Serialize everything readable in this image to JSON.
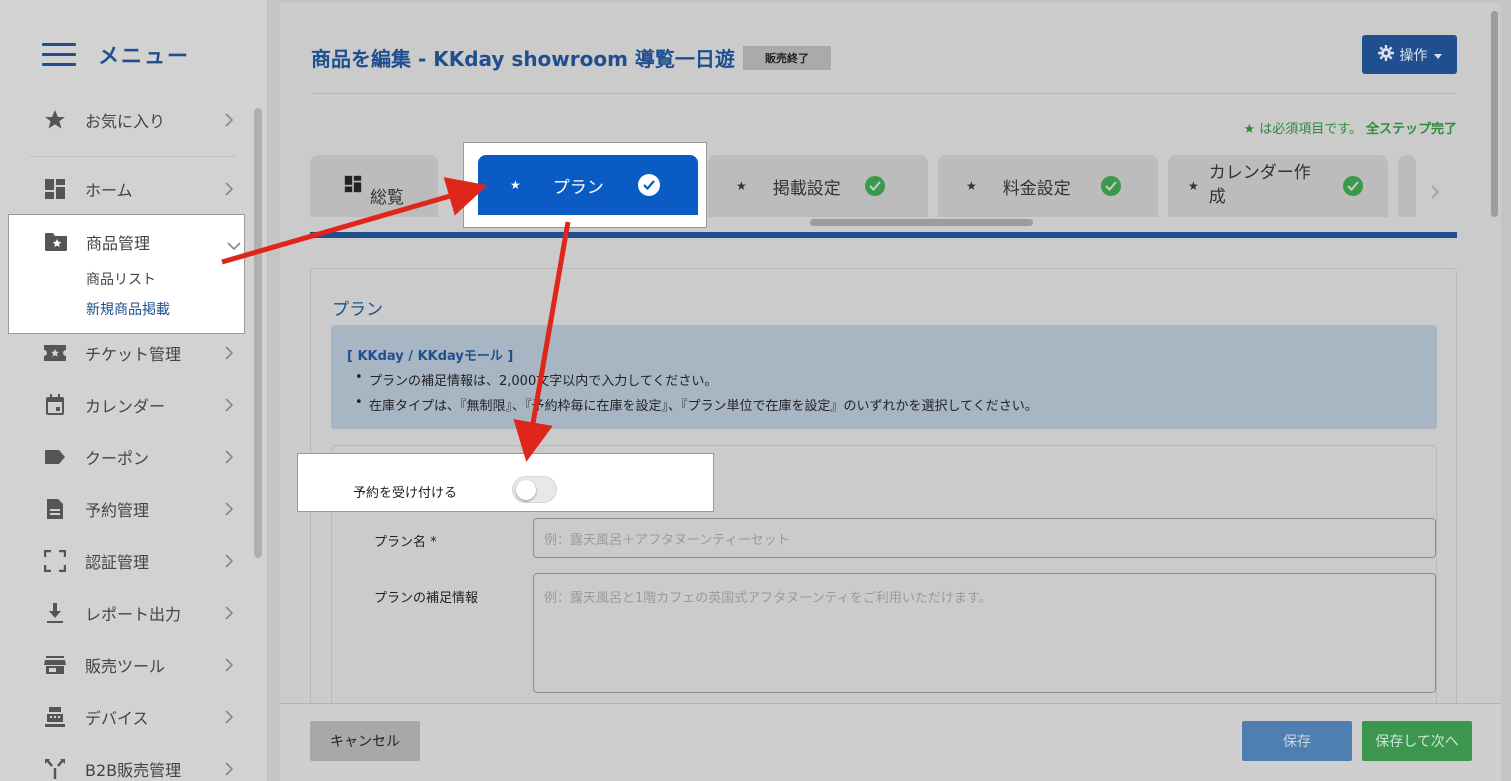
{
  "sidebar": {
    "menu_title": "メニュー",
    "items": [
      {
        "label": "お気に入り",
        "icon": "star-icon"
      },
      {
        "label": "ホーム",
        "icon": "dashboard-icon"
      },
      {
        "label": "商品管理",
        "icon": "folder-star-icon"
      },
      {
        "label": "チケット管理",
        "icon": "ticket-icon"
      },
      {
        "label": "カレンダー",
        "icon": "calendar-icon"
      },
      {
        "label": "クーポン",
        "icon": "tag-icon"
      },
      {
        "label": "予約管理",
        "icon": "document-icon"
      },
      {
        "label": "認証管理",
        "icon": "scan-icon"
      },
      {
        "label": "レポート出力",
        "icon": "download-icon"
      },
      {
        "label": "販売ツール",
        "icon": "store-icon"
      },
      {
        "label": "デバイス",
        "icon": "pos-icon"
      },
      {
        "label": "B2B販売管理",
        "icon": "split-icon"
      }
    ],
    "sub_items": [
      "商品リスト",
      "新規商品掲載"
    ]
  },
  "header": {
    "title": "商品を編集  - KKday showroom 導覧一日遊",
    "status_badge": "販売終了",
    "ops_button": "操作",
    "required_note": "★ は必須項目です。",
    "all_done": "全ステップ完了"
  },
  "tabs": [
    {
      "label": "総覧"
    },
    {
      "label": "プラン",
      "active": true
    },
    {
      "label": "掲載設定"
    },
    {
      "label": "料金設定"
    },
    {
      "label": "カレンダー作成"
    }
  ],
  "panel": {
    "title": "プラン",
    "info_heading": "[ KKday / KKdayモール ]",
    "info_lines": [
      "プランの補足情報は、2,000文字以内で入力してください。",
      "在庫タイプは、『無制限』、『予約枠毎に在庫を設定』、『プラン単位で在庫を設定』のいずれかを選択してください。"
    ],
    "toggle_label": "予約を受け付ける",
    "toggle_on": false,
    "plan_name_label": "プラン名 *",
    "plan_name_placeholder": "例：露天風呂＋アフタヌーンティーセット",
    "plan_info_label": "プランの補足情報",
    "plan_info_placeholder": "例：露天風呂と1階カフェの英国式アフタヌーンティをご利用いただけます。"
  },
  "footer": {
    "cancel": "キャンセル",
    "save": "保存",
    "save_next": "保存して次へ"
  },
  "colors": {
    "brand_blue": "#1f4f8f",
    "active_tab": "#0b5bc5",
    "success_green": "#3a9a4c",
    "annotation_red": "#e0261a"
  }
}
